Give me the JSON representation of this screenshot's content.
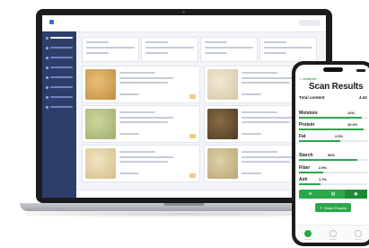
{
  "phone": {
    "back_label": "< Analyzer",
    "title": "Scan Results",
    "total_label": "Total content",
    "total_value": "4.42",
    "metrics": [
      {
        "label": "Moisture",
        "value": "12%",
        "level": 0.92
      },
      {
        "label": "Protein",
        "value": "10.0%",
        "level": 0.95
      },
      {
        "label": "Fat",
        "value": "2.0%",
        "level": 0.6
      },
      {
        "label": "Starch",
        "value": "66%",
        "level": 0.85
      },
      {
        "label": "Fiber",
        "value": "2.9%",
        "level": 0.35
      },
      {
        "label": "Ash",
        "value": "1.7%",
        "level": 0.32
      }
    ],
    "share_label": "Share Results",
    "tabs": [
      "➤",
      "▤",
      "◉"
    ],
    "accent": "#2aa84a"
  },
  "laptop": {
    "sidebar_color": "#2d3e6b",
    "grain_colors": [
      "#d7a85c",
      "#e4d9bf",
      "#b6c389",
      "#6f5636",
      "#e6d6aa",
      "#cfbf92"
    ]
  }
}
